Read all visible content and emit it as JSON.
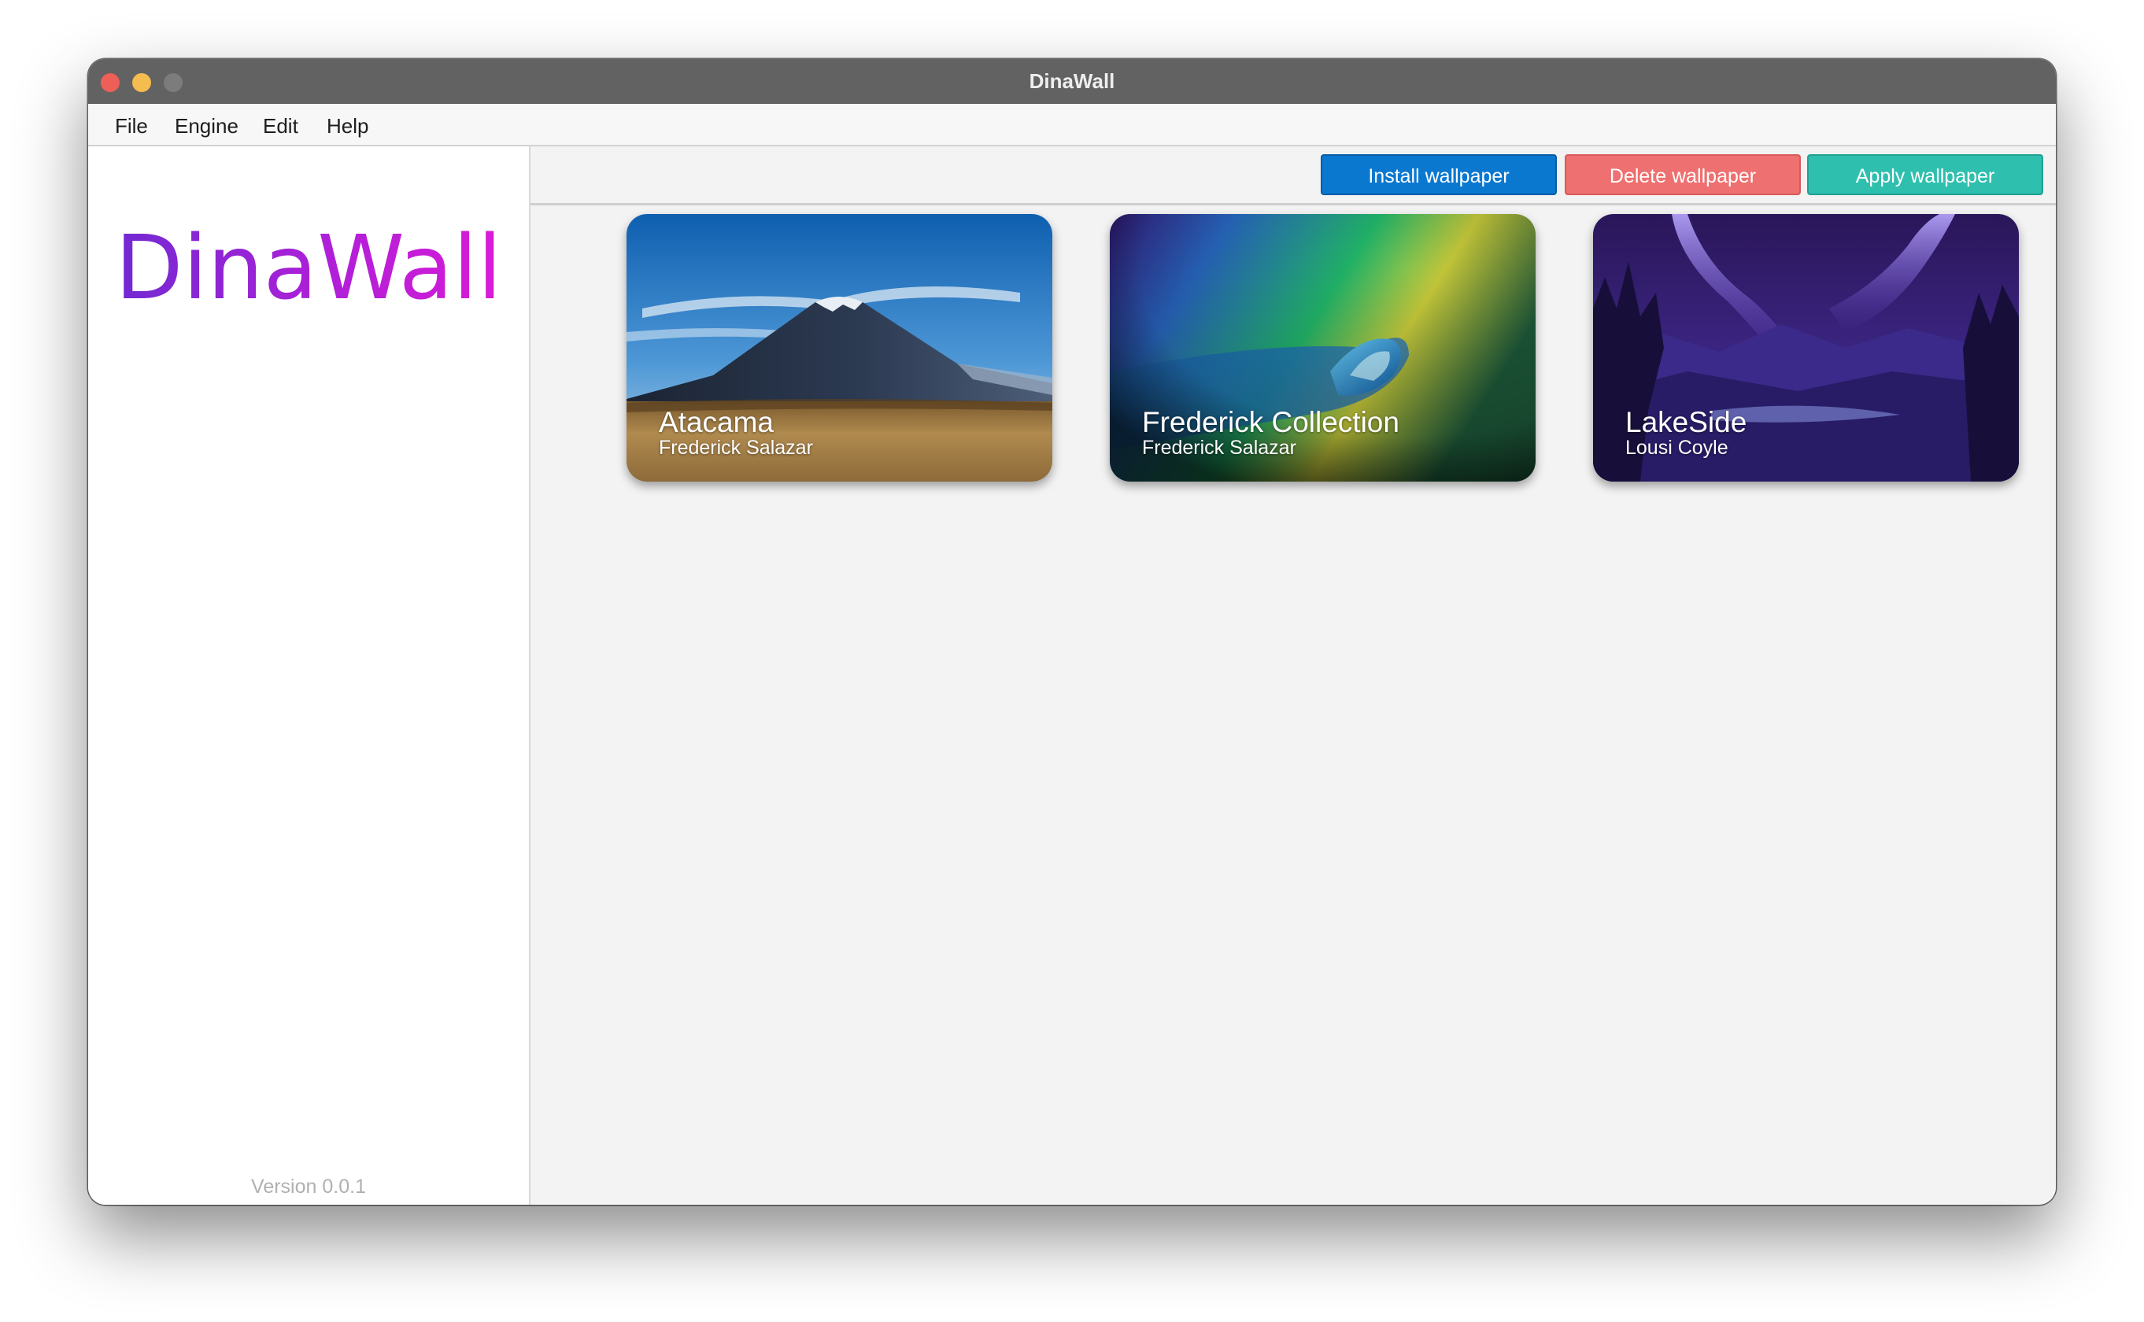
{
  "window": {
    "title": "DinaWall"
  },
  "menu": {
    "items": [
      "File",
      "Engine",
      "Edit",
      "Help"
    ]
  },
  "sidebar": {
    "logo": "DinaWall",
    "version": "Version 0.0.1"
  },
  "toolbar": {
    "install_label": "Install wallpaper",
    "delete_label": "Delete wallpaper",
    "apply_label": "Apply wallpaper"
  },
  "colors": {
    "install": "#0b78d0",
    "delete": "#ee7070",
    "apply": "#2fbfae",
    "logo_gradient": [
      "#6a2bd1",
      "#e01ad9"
    ]
  },
  "wallpapers": [
    {
      "title": "Atacama",
      "author": "Frederick Salazar"
    },
    {
      "title": "Frederick Collection",
      "author": "Frederick Salazar"
    },
    {
      "title": "LakeSide",
      "author": "Lousi Coyle"
    }
  ]
}
